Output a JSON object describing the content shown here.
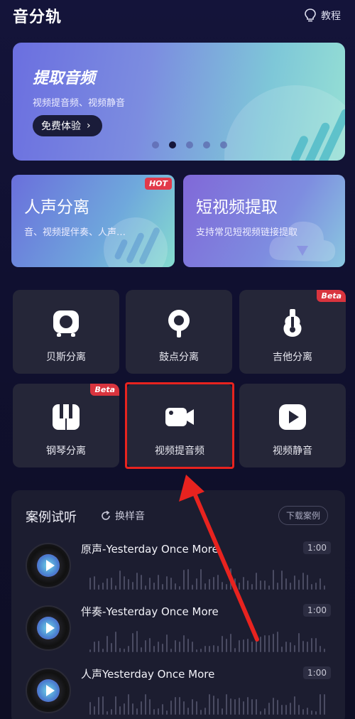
{
  "header": {
    "app_title": "音分轨",
    "tutorial_label": "教程"
  },
  "banner": {
    "title": "提取音频",
    "subtitle": "视频提音频、视频静音",
    "cta_label": "免费体验",
    "cta_chevron": "›",
    "carousel_count": 5,
    "carousel_active_index": 1
  },
  "feature_cards": [
    {
      "title": "人声分离",
      "subtitle": "音、视频提伴奏、人声…",
      "badge": "HOT"
    },
    {
      "title": "短视频提取",
      "subtitle": "支持常见短视频链接提取",
      "badge": ""
    }
  ],
  "tools": [
    {
      "label": "贝斯分离",
      "icon": "bass-speaker-icon",
      "badge": ""
    },
    {
      "label": "鼓点分离",
      "icon": "drum-pin-icon",
      "badge": ""
    },
    {
      "label": "吉他分离",
      "icon": "guitar-icon",
      "badge": "Beta"
    },
    {
      "label": "钢琴分离",
      "icon": "piano-keys-icon",
      "badge": "Beta"
    },
    {
      "label": "视频提音频",
      "icon": "video-camera-icon",
      "badge": ""
    },
    {
      "label": "视频静音",
      "icon": "play-circle-icon",
      "badge": ""
    }
  ],
  "cases": {
    "title": "案例试听",
    "swap_label": "换样音",
    "download_label": "下载案例",
    "tracks": [
      {
        "name": "原声-Yesterday Once More",
        "duration": "1:00"
      },
      {
        "name": "伴奏-Yesterday Once More",
        "duration": "1:00"
      },
      {
        "name": "人声Yesterday Once More",
        "duration": "1:00"
      }
    ]
  },
  "colors": {
    "highlight_box": "#e8231f",
    "arrow": "#e8231f",
    "badge_red": "#d9343e",
    "tile_bg": "#252638"
  }
}
